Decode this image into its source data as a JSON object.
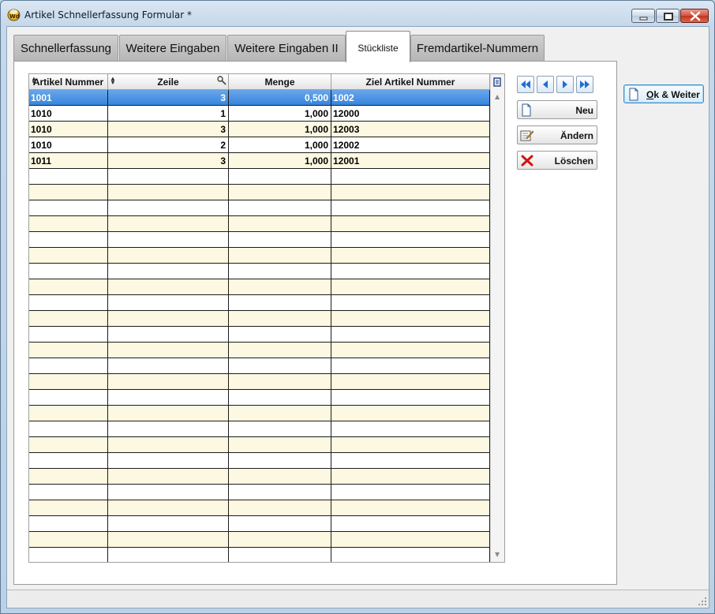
{
  "window": {
    "title": "Artikel Schnellerfassung Formular *"
  },
  "tabs": [
    {
      "label": "Schnellerfassung"
    },
    {
      "label": "Weitere Eingaben"
    },
    {
      "label": "Weitere Eingaben II"
    },
    {
      "label": "Stückliste",
      "active": true
    },
    {
      "label": "Fremdartikel-Nummern"
    }
  ],
  "grid": {
    "columns": [
      "Artikel Nummer",
      "Zeile",
      "Menge",
      "Ziel Artikel Nummer"
    ],
    "rows": [
      [
        "1001",
        "3",
        "0,500",
        "1002"
      ],
      [
        "1010",
        "1",
        "1,000",
        "12000"
      ],
      [
        "1010",
        "3",
        "1,000",
        "12003"
      ],
      [
        "1010",
        "2",
        "1,000",
        "12002"
      ],
      [
        "1011",
        "3",
        "1,000",
        "12001"
      ]
    ],
    "selected_row": 0
  },
  "actions": {
    "new": "Neu",
    "edit": "Ändern",
    "delete": "Löschen"
  },
  "ok_button": {
    "underlined": "O",
    "rest": "k & Weiter"
  },
  "colors": {
    "selection": "#3585dd",
    "odd_row": "#fdf8e1",
    "delete_red": "#d0150f",
    "nav_blue": "#1f6fd1"
  }
}
